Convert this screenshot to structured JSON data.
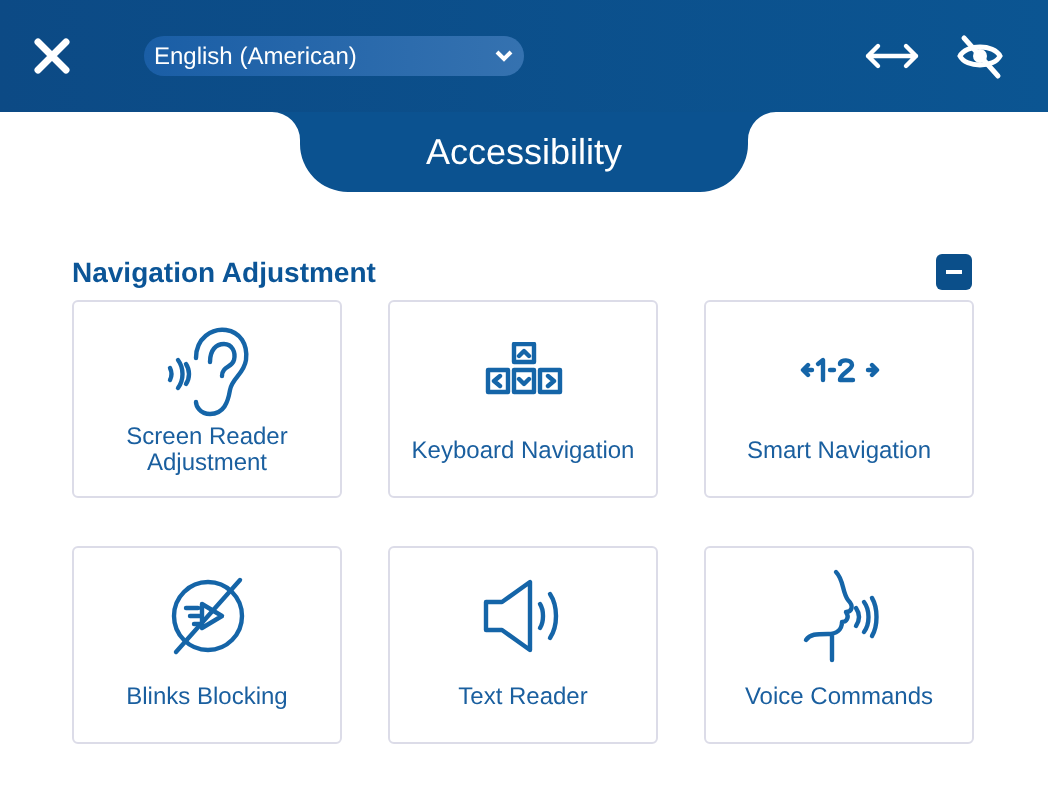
{
  "header": {
    "language": "English (American)"
  },
  "panel_title": "Accessibility",
  "section": {
    "title": "Navigation Adjustment",
    "expanded": true,
    "items": [
      {
        "label": "Screen Reader Adjustment"
      },
      {
        "label": "Keyboard Navigation"
      },
      {
        "label": "Smart Navigation"
      },
      {
        "label": "Blinks Blocking"
      },
      {
        "label": "Text Reader"
      },
      {
        "label": "Voice Commands"
      }
    ]
  }
}
